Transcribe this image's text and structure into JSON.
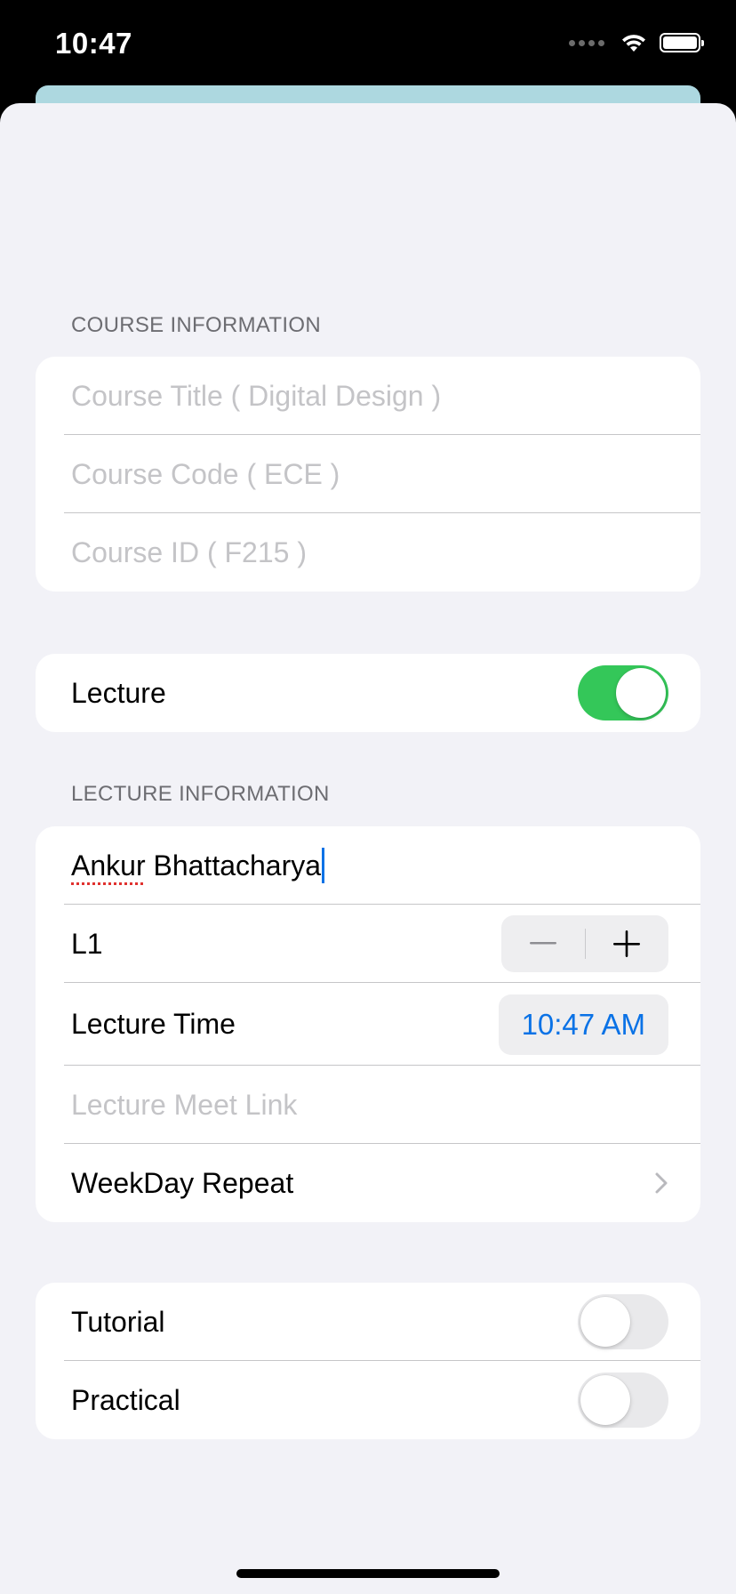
{
  "status_bar": {
    "time": "10:47"
  },
  "course_info": {
    "header": "COURSE INFORMATION",
    "title_placeholder": "Course Title ( Digital Design )",
    "code_placeholder": "Course Code ( ECE )",
    "id_placeholder": "Course ID ( F215 )"
  },
  "lecture_toggle": {
    "label": "Lecture",
    "on": true
  },
  "lecture_info": {
    "header": "LECTURE INFORMATION",
    "instructor_first": "Ankur",
    "instructor_rest": " Bhattacharya",
    "section_label": "L1",
    "time_label": "Lecture Time",
    "time_value": "10:47 AM",
    "meet_link_placeholder": "Lecture Meet Link",
    "repeat_label": "WeekDay Repeat"
  },
  "other_sessions": {
    "tutorial": {
      "label": "Tutorial",
      "on": false
    },
    "practical": {
      "label": "Practical",
      "on": false
    }
  },
  "colors": {
    "accent": "#0a72e6",
    "toggle_on": "#34c759",
    "background": "#f2f2f7",
    "behind_sheet": "#add8e0"
  }
}
